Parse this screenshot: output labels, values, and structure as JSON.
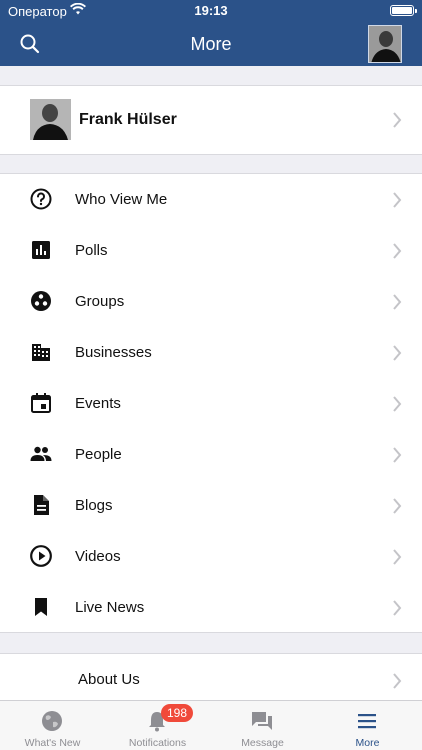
{
  "status_bar": {
    "carrier": "Оператор",
    "time": "19:13"
  },
  "nav": {
    "title": "More",
    "left_icon": "search-icon"
  },
  "profile": {
    "name": "Frank Hülser"
  },
  "menu": [
    {
      "label": "Who View Me",
      "icon": "help-circle-icon"
    },
    {
      "label": "Polls",
      "icon": "poll-chart-icon"
    },
    {
      "label": "Groups",
      "icon": "groups-icon"
    },
    {
      "label": "Businesses",
      "icon": "building-icon"
    },
    {
      "label": "Events",
      "icon": "calendar-icon"
    },
    {
      "label": "People",
      "icon": "people-icon"
    },
    {
      "label": "Blogs",
      "icon": "document-icon"
    },
    {
      "label": "Videos",
      "icon": "play-circle-icon"
    },
    {
      "label": "Live News",
      "icon": "bookmark-icon"
    }
  ],
  "about": {
    "label": "About Us"
  },
  "tabs": [
    {
      "label": "What's New",
      "icon": "globe-icon"
    },
    {
      "label": "Notifications",
      "icon": "bell-icon",
      "badge": "198"
    },
    {
      "label": "Message",
      "icon": "chat-icon"
    },
    {
      "label": "More",
      "icon": "menu-icon",
      "active": true
    }
  ],
  "colors": {
    "brand": "#2b5289",
    "badge": "#f04a3a"
  }
}
